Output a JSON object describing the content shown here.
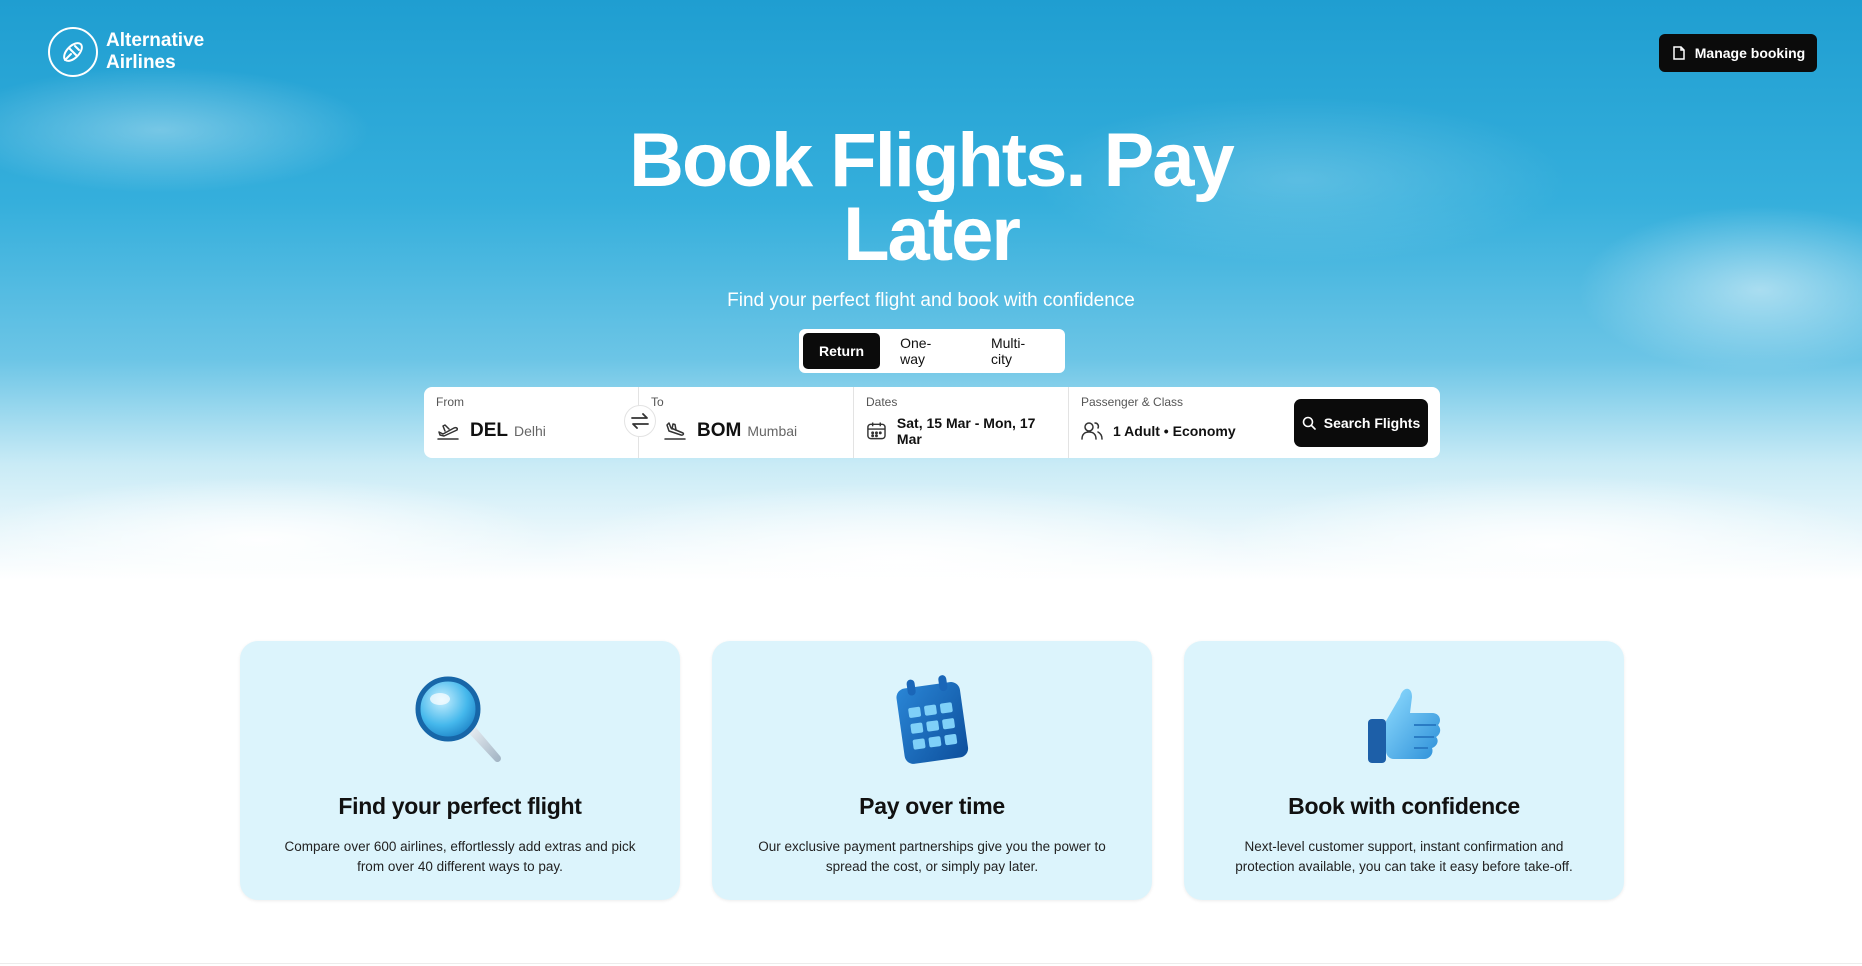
{
  "brand": {
    "name_line1": "Alternative",
    "name_line2": "Airlines"
  },
  "header": {
    "manage_booking_label": "Manage booking"
  },
  "hero": {
    "headline_line1": "Book Flights. Pay",
    "headline_line2": "Later",
    "subheadline": "Find your perfect flight and book with confidence"
  },
  "trip_types": [
    {
      "label": "Return",
      "active": true
    },
    {
      "label": "One-way",
      "active": false
    },
    {
      "label": "Multi-city",
      "active": false
    }
  ],
  "search": {
    "from": {
      "label": "From",
      "code": "DEL",
      "city": "Delhi"
    },
    "to": {
      "label": "To",
      "code": "BOM",
      "city": "Mumbai"
    },
    "dates": {
      "label": "Dates",
      "value": "Sat, 15 Mar - Mon, 17 Mar"
    },
    "passengers": {
      "label": "Passenger & Class",
      "value": "1 Adult • Economy"
    },
    "button_label": "Search Flights"
  },
  "features": [
    {
      "icon": "magnifier-icon",
      "title": "Find your perfect flight",
      "description": "Compare over 600 airlines, effortlessly add extras and pick from over 40 different ways to pay."
    },
    {
      "icon": "calendar-icon",
      "title": "Pay over time",
      "description": "Our exclusive payment partnerships give you the power to spread the cost, or simply pay later."
    },
    {
      "icon": "thumbs-up-icon",
      "title": "Book with confidence",
      "description": "Next-level customer support, instant confirmation and protection available, you can take it easy before take-off."
    }
  ],
  "colors": {
    "primary_dark": "#0b0b0b",
    "sky_blue": "#1f9ed1",
    "card_bg": "#dcf4fc"
  }
}
